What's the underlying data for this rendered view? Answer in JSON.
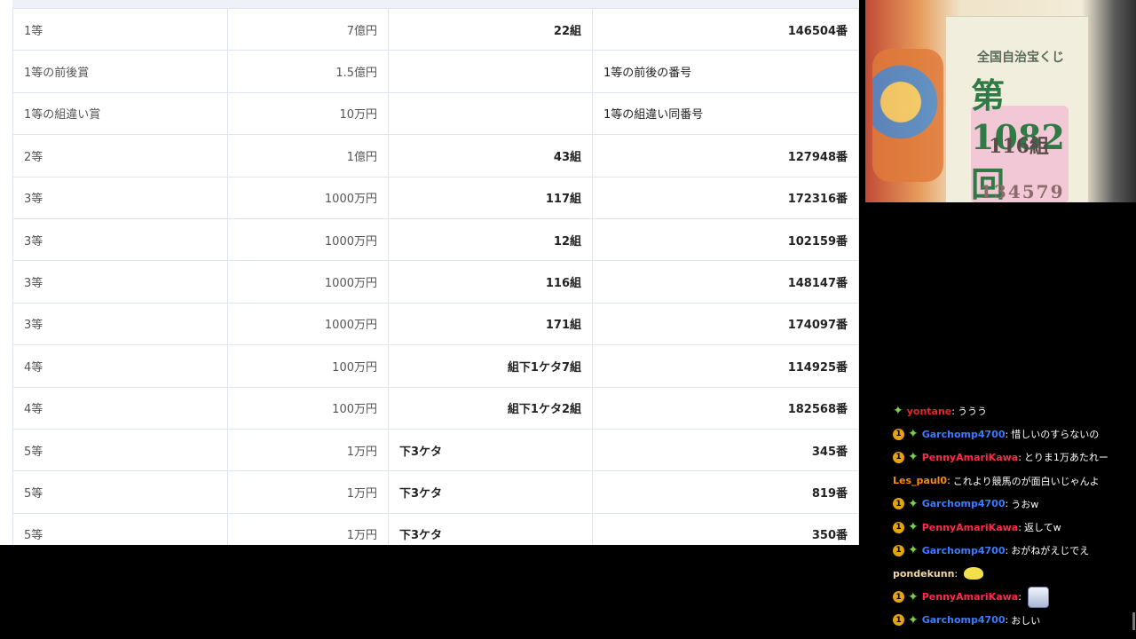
{
  "table": {
    "rows": [
      {
        "rank": "1等",
        "amount": "7億円",
        "group": "22組",
        "number": "146504番",
        "group_align": "right",
        "number_align": "right",
        "note": false
      },
      {
        "rank": "1等の前後賞",
        "amount": "1.5億円",
        "group": "",
        "number": "1等の前後の番号",
        "group_align": "right",
        "number_align": "left",
        "note": true
      },
      {
        "rank": "1等の組違い賞",
        "amount": "10万円",
        "group": "",
        "number": "1等の組違い同番号",
        "group_align": "right",
        "number_align": "left",
        "note": true
      },
      {
        "rank": "2等",
        "amount": "1億円",
        "group": "43組",
        "number": "127948番",
        "group_align": "right",
        "number_align": "right",
        "note": false
      },
      {
        "rank": "3等",
        "amount": "1000万円",
        "group": "117組",
        "number": "172316番",
        "group_align": "right",
        "number_align": "right",
        "note": false
      },
      {
        "rank": "3等",
        "amount": "1000万円",
        "group": "12組",
        "number": "102159番",
        "group_align": "right",
        "number_align": "right",
        "note": false
      },
      {
        "rank": "3等",
        "amount": "1000万円",
        "group": "116組",
        "number": "148147番",
        "group_align": "right",
        "number_align": "right",
        "note": false
      },
      {
        "rank": "3等",
        "amount": "1000万円",
        "group": "171組",
        "number": "174097番",
        "group_align": "right",
        "number_align": "right",
        "note": false
      },
      {
        "rank": "4等",
        "amount": "100万円",
        "group": "組下1ケタ7組",
        "number": "114925番",
        "group_align": "right",
        "number_align": "right",
        "note": false
      },
      {
        "rank": "4等",
        "amount": "100万円",
        "group": "組下1ケタ2組",
        "number": "182568番",
        "group_align": "right",
        "number_align": "right",
        "note": false
      },
      {
        "rank": "5等",
        "amount": "1万円",
        "group": "下3ケタ",
        "number": "345番",
        "group_align": "left",
        "number_align": "right",
        "note": false
      },
      {
        "rank": "5等",
        "amount": "1万円",
        "group": "下3ケタ",
        "number": "819番",
        "group_align": "left",
        "number_align": "right",
        "note": false
      },
      {
        "rank": "5等",
        "amount": "1万円",
        "group": "下3ケタ",
        "number": "350番",
        "group_align": "left",
        "number_align": "right",
        "note": false
      }
    ]
  },
  "webcam": {
    "poster_lines": [
      "全国自治宝くじ",
      "第1082回",
      "116組",
      "134579"
    ]
  },
  "chat": {
    "messages": [
      {
        "user": "yontane",
        "color": "#e02a2a",
        "sub": false,
        "star": true,
        "text": "ううう",
        "emote": ""
      },
      {
        "user": "Garchomp4700",
        "color": "#3b7bff",
        "sub": true,
        "star": true,
        "text": "惜しいのすらないの",
        "emote": ""
      },
      {
        "user": "PennyAmariKawa",
        "color": "#ff2a4a",
        "sub": true,
        "star": true,
        "text": "とりま1万あたれー",
        "emote": ""
      },
      {
        "user": "Les_paul0",
        "color": "#ff8a00",
        "sub": false,
        "star": false,
        "text": "これより競馬のが面白いじゃんよ",
        "emote": ""
      },
      {
        "user": "Garchomp4700",
        "color": "#3b7bff",
        "sub": true,
        "star": true,
        "text": "うおw",
        "emote": ""
      },
      {
        "user": "PennyAmariKawa",
        "color": "#ff2a4a",
        "sub": true,
        "star": true,
        "text": "返してw",
        "emote": ""
      },
      {
        "user": "Garchomp4700",
        "color": "#3b7bff",
        "sub": true,
        "star": true,
        "text": "おがねがえじでえ",
        "emote": ""
      },
      {
        "user": "pondekunn",
        "color": "#f2d8a6",
        "sub": false,
        "star": false,
        "text": "",
        "emote": "duck"
      },
      {
        "user": "PennyAmariKawa",
        "color": "#ff2a4a",
        "sub": true,
        "star": true,
        "text": "",
        "emote": "kaiju"
      },
      {
        "user": "Garchomp4700",
        "color": "#3b7bff",
        "sub": true,
        "star": true,
        "text": "おしい",
        "emote": ""
      }
    ]
  }
}
